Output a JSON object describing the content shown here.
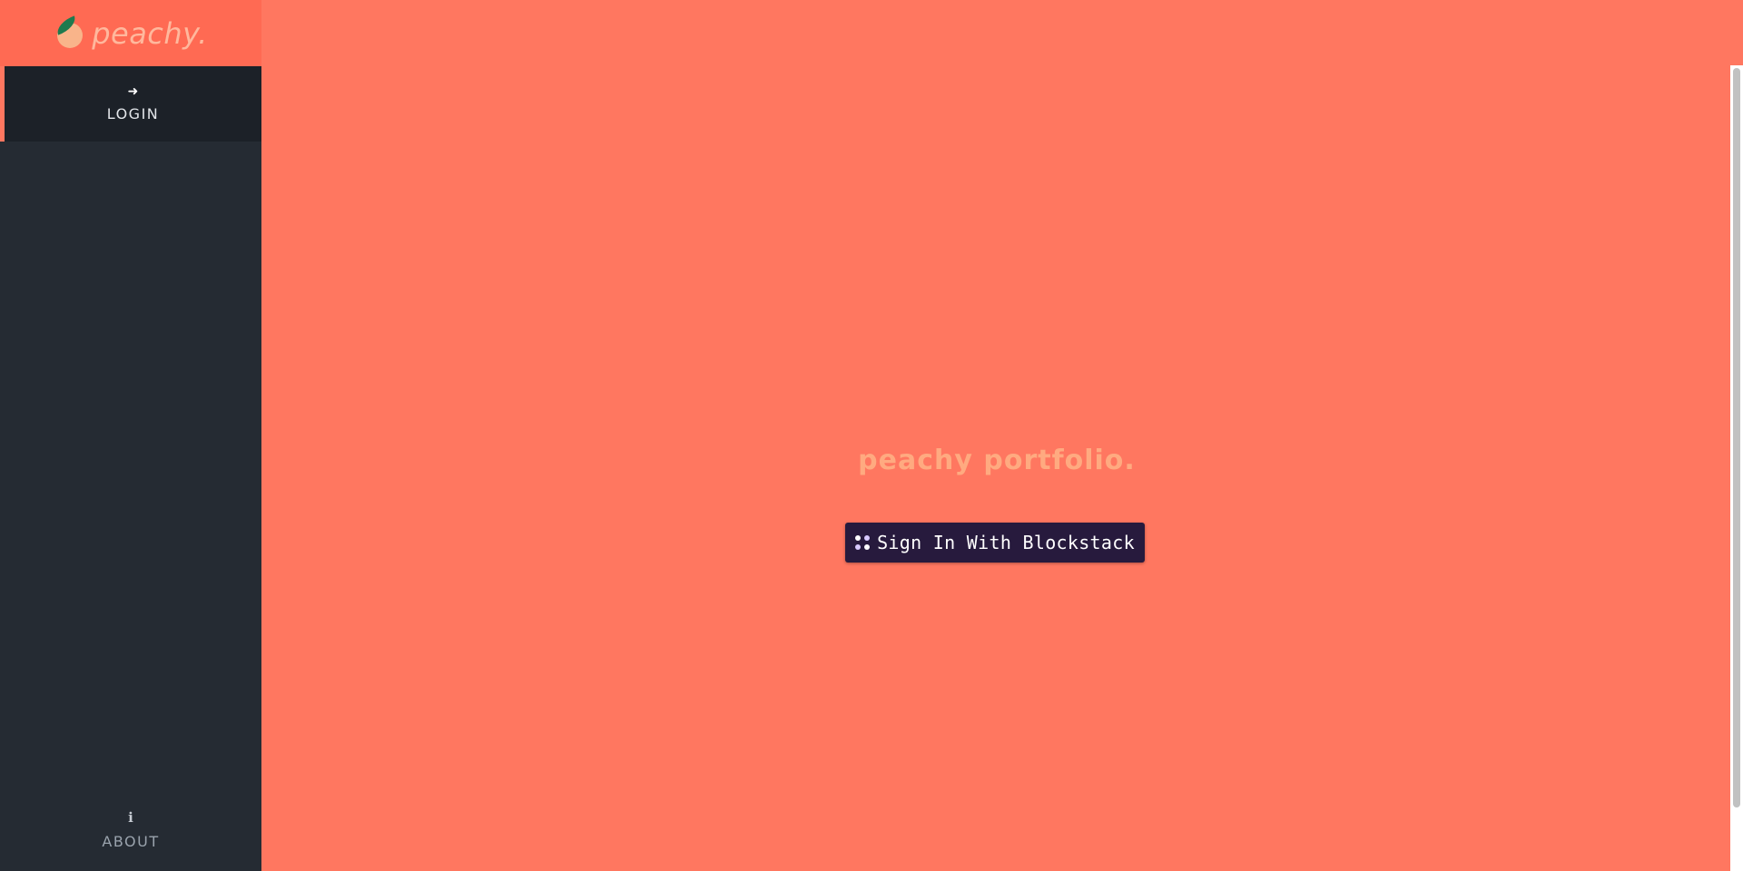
{
  "brand": {
    "name": "peachy.",
    "logo_icon": "peach-icon"
  },
  "sidebar": {
    "items": [
      {
        "label": "LOGIN",
        "icon": "sign-in-icon",
        "glyph": "➜"
      },
      {
        "label": "ABOUT",
        "icon": "info-icon",
        "glyph": "ℹ"
      }
    ]
  },
  "main": {
    "title": "peachy portfolio.",
    "signin_button": {
      "label": "Sign In With Blockstack",
      "icon": "blockstack-icon"
    }
  },
  "colors": {
    "background": "#ff7760",
    "sidebar": "#252b33",
    "brand_bar": "#ff6a53",
    "button": "#271a3d",
    "title": "#ffaa80"
  }
}
